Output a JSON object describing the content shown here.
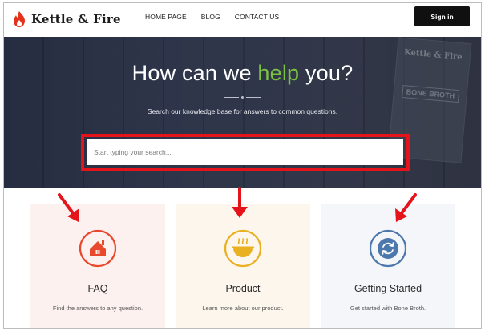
{
  "brand": {
    "name": "Kettle & Fire",
    "accent": "#e5331b"
  },
  "nav": {
    "items": [
      "HOME PAGE",
      "BLOG",
      "CONTACT US"
    ]
  },
  "header": {
    "signin_label": "Sign in"
  },
  "hero": {
    "title_pre": "How can we ",
    "title_highlight": "help",
    "title_post": " you?",
    "subtitle": "Search our knowledge base for answers to common questions.",
    "search_placeholder": "Start typing your search...",
    "highlight_color": "#7cc242",
    "box_text_1": "Kettle & Fire",
    "box_text_2": "BONE BROTH"
  },
  "cards": [
    {
      "title": "FAQ",
      "description": "Find the answers to any question.",
      "icon": "house-icon",
      "color": "#e8482c"
    },
    {
      "title": "Product",
      "description": "Learn more about our product.",
      "icon": "soup-bowl-icon",
      "color": "#e9b022"
    },
    {
      "title": "Getting Started",
      "description": "Get started with Bone Broth.",
      "icon": "refresh-icon",
      "color": "#4d78ad"
    }
  ],
  "annotations": {
    "color": "#e5141b"
  }
}
